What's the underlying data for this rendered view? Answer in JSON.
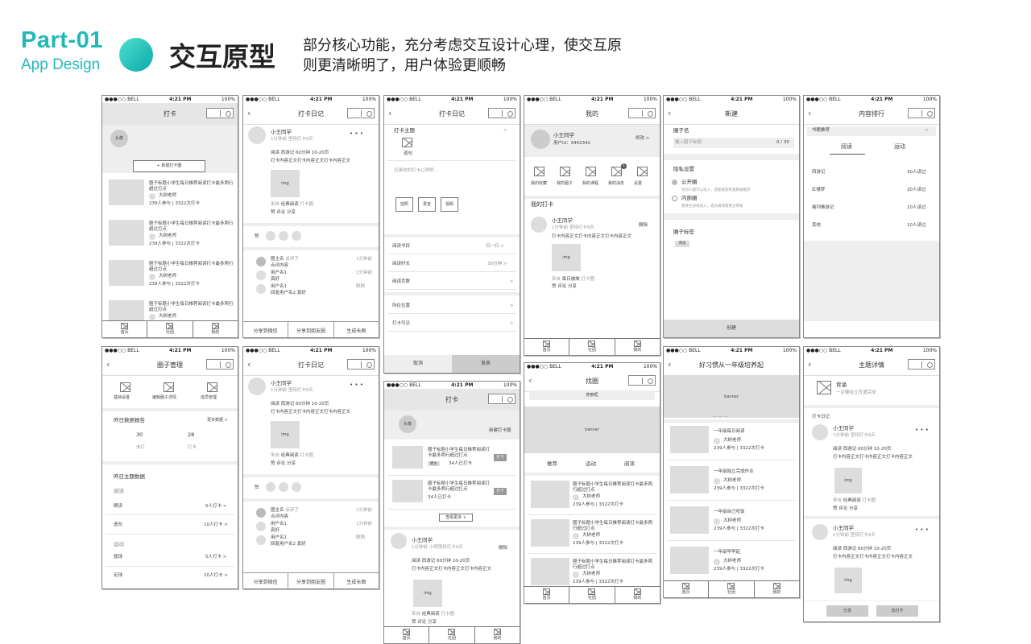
{
  "header": {
    "part": "Part-01",
    "app": "App Design",
    "title": "交互原型",
    "desc1": "部分核心功能，充分考虑交互设计心理，使交互原",
    "desc2": "则更清晰明了，用户体验更顺畅"
  },
  "status": {
    "bell": "●●●○○ BELL",
    "time": "4:21 PM",
    "batt": "100%"
  },
  "tabs": [
    "首页",
    "社团",
    "我的"
  ],
  "colors": {
    "accent": "#22b8b8"
  },
  "s1": {
    "title": "打卡",
    "avatar": "头像",
    "new_btn": "+ 新建打卡圈",
    "items": [
      {
        "text": "圈子标题小学生每日推荐阅读打卡最多两行超过打点",
        "author": "大树老师",
        "stats": "239人参与  |  3322次打卡"
      },
      {
        "text": "圈子标题小学生每日推荐阅读打卡最多两行超过打点",
        "author": "大树老师",
        "stats": "239人参与  |  3322次打卡"
      },
      {
        "text": "圈子标题小学生每日推荐阅读打卡最多两行超过打点",
        "author": "大树老师",
        "stats": "239人参与  |  3322次打卡"
      },
      {
        "text": "圈子标题小学生每日推荐阅读打卡最多两行超过打点",
        "author": "大树老师",
        "stats": "239人参与  |  3322次打卡"
      }
    ]
  },
  "diary": {
    "title": "打卡日记",
    "user": "小王同学",
    "meta": "1分钟前   坚持打卡9天",
    "dots": "• • •",
    "line1": "阅读 西游记 60分钟 10-20页",
    "line2": "打卡内容正文打卡内容正文打卡内容正文",
    "img": "img",
    "src": "来自",
    "book": "经典阅读",
    "check": "打卡圈",
    "like": "赞",
    "comment": "评论",
    "share": "分享",
    "zan": "赞",
    "comments": [
      {
        "name": "圈主名",
        "action": "点评了",
        "text": "点评内容",
        "time": "1分钟前"
      },
      {
        "name": "用户名1",
        "text": "真好",
        "time": "1分钟前"
      },
      {
        "name": "用户名1",
        "text": "回复用户名2  真好",
        "time": "刚刚"
      }
    ],
    "b1": "分享到微信",
    "b2": "分享到朋友圈",
    "b3": "生成长图"
  },
  "s3": {
    "title": "打卡日记",
    "topic": "打卡主题",
    "chev": ">",
    "tag": "道句",
    "placeholder": "记录你的打卡心得吧...",
    "btns": [
      "拍照",
      "录音",
      "视频"
    ],
    "rows": [
      {
        "l": "阅读书目",
        "r": "扫一扫 >"
      },
      {
        "l": "阅读时长",
        "r": "30分钟 >"
      },
      {
        "l": "阅读页数",
        "r": ">"
      },
      {
        "l": "所在位置",
        "r": ">"
      },
      {
        "l": "打卡可见",
        "r": ">"
      }
    ],
    "cancel": "取消",
    "send": "发表"
  },
  "s4": {
    "title": "我的",
    "user": "小王同学",
    "uid": "用户id：3442342",
    "edit": "修改 >",
    "icons": [
      {
        "label": "我的收藏"
      },
      {
        "label": "我的圈子"
      },
      {
        "label": "我的课程"
      },
      {
        "label": "我的消息",
        "badge": "1"
      },
      {
        "label": "设置"
      }
    ],
    "section": "我的打卡",
    "del": "删除",
    "book": "每日被故"
  },
  "s5": {
    "title": "新建",
    "circle": "圈子名",
    "circle_ph": "输入圈子标题",
    "count": "0 / 30",
    "privacy": "隐私设置",
    "pub": "公开圈",
    "pub_desc": "任何人都可以加入，且能搜索和查看被推荐",
    "pri": "内部圈",
    "pri_desc": "需要主退请加入，成员邀请需要主审核",
    "tags": "圈子标签",
    "tag1": "阅读",
    "create": "创建"
  },
  "s6": {
    "title": "内容排行",
    "rec": "书籍推荐",
    "tab1": "阅读",
    "tab2": "运动",
    "rank": [
      {
        "n": "西游记",
        "c": "30人读过"
      },
      {
        "n": "红楼梦",
        "c": "20人读过"
      },
      {
        "n": "格列佛游记",
        "c": "10人读过"
      },
      {
        "n": "其他",
        "c": "10人读过"
      }
    ]
  },
  "s7": {
    "title": "圈子管理",
    "icons": [
      "基础设置",
      "编辑圈子详情",
      "成员管理"
    ],
    "yesterday": "昨日数据报告",
    "more": "更多数据 >",
    "v1": "30",
    "v2": "28",
    "l1": "未打",
    "l2": "打卡",
    "topic": "昨日主题数据",
    "cat1": "阅读",
    "r1": "朗读",
    "r1v": "5人打卡  >",
    "r2": "造句",
    "r2v": "10人打卡  >",
    "cat2": "运动",
    "r3": "篮球",
    "r3v": "5人打卡  >",
    "r4": "足球",
    "r4v": "10人打卡  >"
  },
  "s9": {
    "title": "打卡",
    "avatar": "头像",
    "new": "新建打卡圈",
    "item": "圈子标题小学生每日推荐阅读打卡最多两行超过打点",
    "badge": "圈主",
    "count": "34人已打卡",
    "dk": "打卡",
    "seeall": "查看更多 ∨",
    "user": "小王同学",
    "meta": "1分钟前  小明坚持打卡9天",
    "del": "删除",
    "book": "打卡圈"
  },
  "s10": {
    "title": "找圈",
    "search": "搜索框",
    "banner": "banner",
    "tabs": [
      "推荐",
      "运动",
      "阅读"
    ]
  },
  "s11": {
    "title": "好习惯从一年级培养起",
    "banner": "banner",
    "items": [
      {
        "t": "一年级每日阅读"
      },
      {
        "t": "一年级独立完成作业"
      },
      {
        "t": "一年级自己吃饭"
      },
      {
        "t": "一年级早早起"
      }
    ],
    "author": "大树老师",
    "stats": "239人参与  |  3322次打卡"
  },
  "s12": {
    "title": "主题详情",
    "topic": "背诵",
    "desc": "一定要给立背诵完成",
    "sec": "打卡日记",
    "share": "分享",
    "go": "去打卡"
  }
}
